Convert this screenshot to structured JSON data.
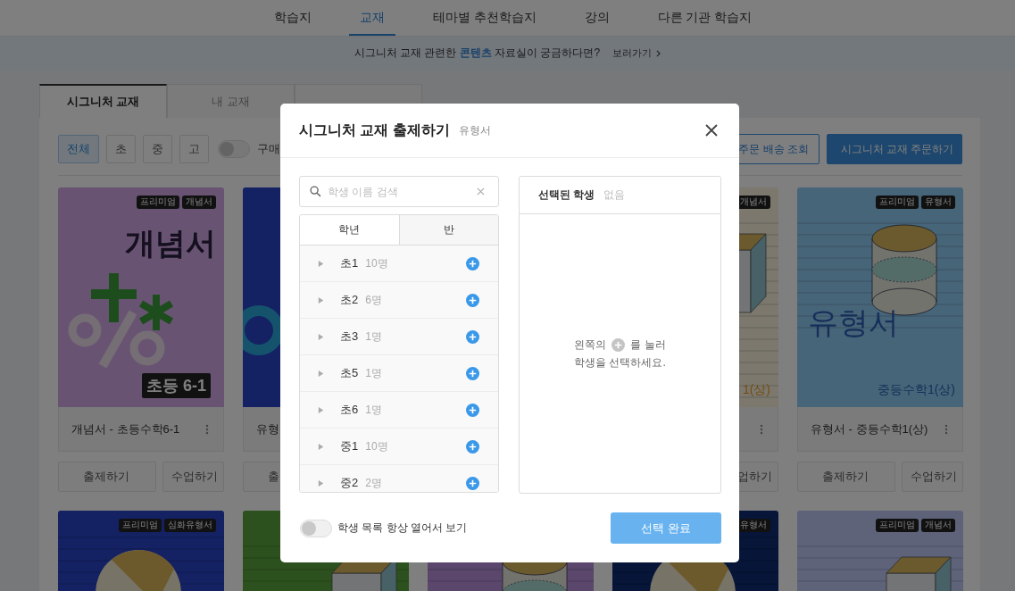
{
  "top_nav": [
    {
      "label": "학습지",
      "selected": false
    },
    {
      "label": "교재",
      "selected": true
    },
    {
      "label": "테마별 추천학습지",
      "selected": false
    },
    {
      "label": "강의",
      "selected": false
    },
    {
      "label": "다른 기관 학습지",
      "selected": false
    }
  ],
  "banner": {
    "text": "시그니처 교재 관련한 **콘텐츠** 자료실이 궁금하다면?",
    "link": "보러가기"
  },
  "book_tabs": [
    {
      "label": "시그니처 교재",
      "selected": true
    },
    {
      "label": "내 교재",
      "selected": false
    },
    {
      "selected": false
    }
  ],
  "toolbar": {
    "filters": [
      {
        "label": "전체",
        "selected": true
      },
      {
        "label": "초",
        "selected": false
      },
      {
        "label": "중",
        "selected": false
      },
      {
        "label": "고",
        "selected": false
      }
    ],
    "purchased_toggle": {
      "label": "구매",
      "on": false
    },
    "actions": [
      {
        "label": "주문 배송 조회",
        "kind": "outline"
      },
      {
        "label": "시그니처 교재 주문하기",
        "kind": "primary"
      }
    ]
  },
  "book_rows": [
    [
      {
        "color": "#685472",
        "kind": "symbols",
        "tags": [
          "프리미엄",
          "개념서"
        ],
        "cover_title": "개념서",
        "grade_badge": "초등 6-1",
        "title": "개념서 - 초등수학6-1",
        "menu": true,
        "buttons": [
          {
            "kind": "assign",
            "label": "출제하기"
          },
          {
            "kind": "lesson",
            "label": "수업하기"
          }
        ]
      },
      {
        "color": "#142264",
        "kind": "ring",
        "title": "유형",
        "buttons": [
          {
            "kind": "assign",
            "label": "출"
          }
        ]
      },
      {},
      {
        "color": "#7c786e",
        "kind": "box",
        "tags": [
          "개념서"
        ],
        "cover_subtitle": "1(상)",
        "menu": true,
        "buttons": [
          {
            "kind": "lesson",
            "label": "업하기"
          }
        ]
      },
      {
        "color": "#476578",
        "kind": "cylinder",
        "tags": [
          "프리미엄",
          "유형서"
        ],
        "cover_title": "유형서",
        "cover_subtitle": "중등수학1(상)",
        "title": "유형서 - 중등수학1(상)",
        "menu": true,
        "buttons": [
          {
            "kind": "assign",
            "label": "출제하기"
          },
          {
            "kind": "lesson",
            "label": "수업하기"
          }
        ]
      }
    ],
    [
      {
        "color": "#142162",
        "kind": "ball",
        "tags": [
          "프리미엄",
          "심화유형서"
        ]
      },
      {
        "color": "#2d511e",
        "kind": "box"
      },
      {
        "color": "#5a476b",
        "kind": "cylinder"
      },
      {
        "color": "#061538",
        "kind": "ball",
        "tags": [
          "유형서"
        ]
      },
      {
        "color": "#5e637a",
        "kind": "box",
        "tags": [
          "프리미엄",
          "개념서"
        ]
      }
    ]
  ],
  "modal": {
    "title": "시그니처 교재 출제하기",
    "subtitle": "유형서",
    "search": {
      "placeholder": "학생 이름 검색"
    },
    "group_tabs": [
      {
        "label": "학년",
        "selected": true
      },
      {
        "label": "반",
        "selected": false
      }
    ],
    "groups": [
      {
        "name": "초1",
        "count": "10명",
        "expanded": false
      },
      {
        "name": "초2",
        "count": "6명",
        "expanded": false
      },
      {
        "name": "초3",
        "count": "1명",
        "expanded": false
      },
      {
        "name": "초5",
        "count": "1명",
        "expanded": false
      },
      {
        "name": "초6",
        "count": "1명",
        "expanded": false
      },
      {
        "name": "중1",
        "count": "10명",
        "expanded": false
      },
      {
        "name": "중2",
        "count": "2명",
        "expanded": false
      }
    ],
    "selected_panel": {
      "title": "선택된 학생",
      "status": "없음",
      "hint_before": "왼쪽의",
      "hint_after": "를 눌러",
      "hint_line2": "학생을 선택하세요."
    },
    "always_open_toggle": {
      "label": "학생 목록 항상 열어서 보기",
      "on": false
    },
    "confirm_button": {
      "label": "선택 완료",
      "disabled": true
    }
  }
}
